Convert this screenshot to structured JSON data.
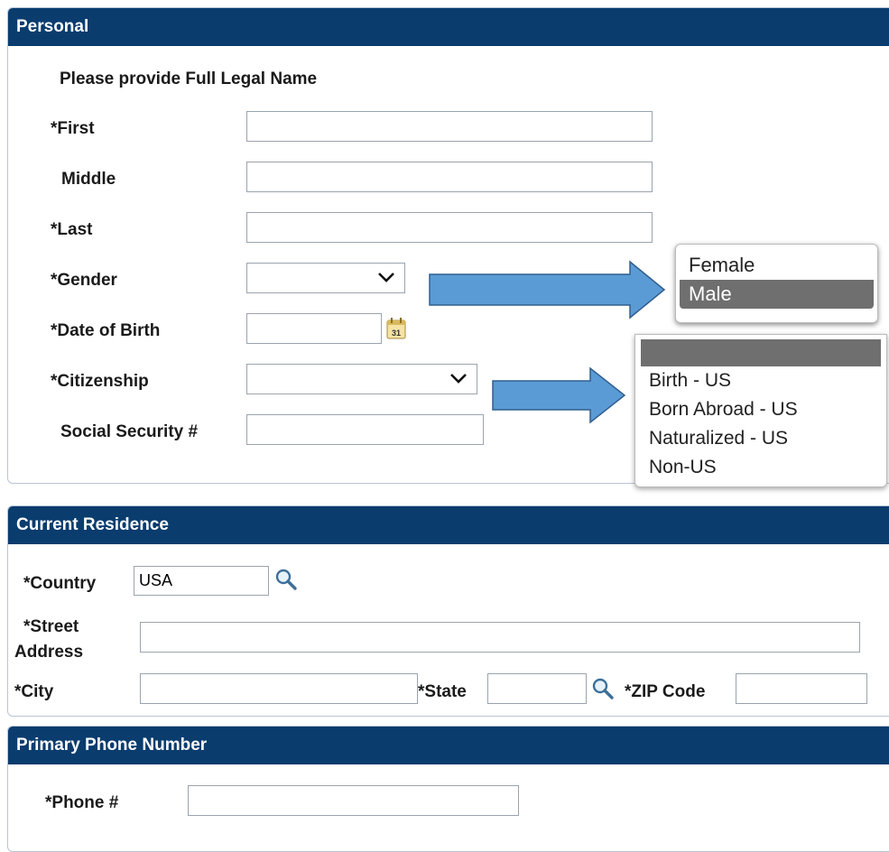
{
  "personal": {
    "title": "Personal",
    "instruction": "Please provide Full Legal Name",
    "first_label": "*First",
    "middle_label": "Middle",
    "last_label": "*Last",
    "gender_label": "*Gender",
    "dob_label": "*Date of Birth",
    "citizenship_label": "*Citizenship",
    "ssn_label": "Social Security #",
    "first_value": "",
    "middle_value": "",
    "last_value": "",
    "gender_value": "",
    "dob_value": "",
    "citizenship_value": "",
    "ssn_value": "",
    "calendar_icon_text": "31"
  },
  "gender_dropdown": {
    "options": [
      "Female",
      "Male"
    ],
    "highlighted": "Male"
  },
  "citizenship_dropdown": {
    "options": [
      "",
      "Birth - US",
      "Born Abroad - US",
      "Naturalized - US",
      "Non-US"
    ],
    "highlighted": ""
  },
  "residence": {
    "title": "Current Residence",
    "country_label": "*Country",
    "country_value": "USA",
    "street_label_line1": "*Street",
    "street_label_line2": "Address",
    "street_value": "",
    "city_label": "*City",
    "city_value": "",
    "state_label": "*State",
    "state_value": "",
    "zip_label": "*ZIP Code",
    "zip_value": ""
  },
  "phone": {
    "title": "Primary Phone Number",
    "phone_label": "*Phone #",
    "phone_value": ""
  },
  "colors": {
    "header": "#0a3c6e",
    "arrow": "#5b9bd5",
    "highlight": "#6f6f6f"
  }
}
